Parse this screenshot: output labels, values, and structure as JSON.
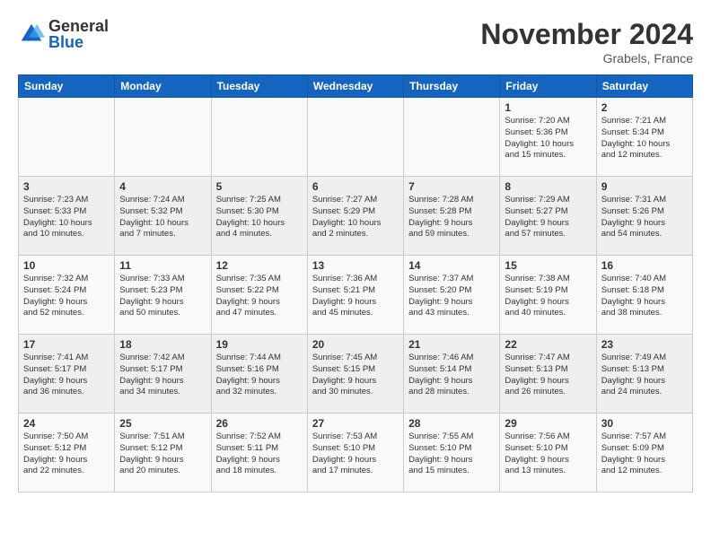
{
  "header": {
    "logo_general": "General",
    "logo_blue": "Blue",
    "month_title": "November 2024",
    "location": "Grabels, France"
  },
  "weekdays": [
    "Sunday",
    "Monday",
    "Tuesday",
    "Wednesday",
    "Thursday",
    "Friday",
    "Saturday"
  ],
  "weeks": [
    [
      {
        "day": "",
        "info": ""
      },
      {
        "day": "",
        "info": ""
      },
      {
        "day": "",
        "info": ""
      },
      {
        "day": "",
        "info": ""
      },
      {
        "day": "",
        "info": ""
      },
      {
        "day": "1",
        "info": "Sunrise: 7:20 AM\nSunset: 5:36 PM\nDaylight: 10 hours\nand 15 minutes."
      },
      {
        "day": "2",
        "info": "Sunrise: 7:21 AM\nSunset: 5:34 PM\nDaylight: 10 hours\nand 12 minutes."
      }
    ],
    [
      {
        "day": "3",
        "info": "Sunrise: 7:23 AM\nSunset: 5:33 PM\nDaylight: 10 hours\nand 10 minutes."
      },
      {
        "day": "4",
        "info": "Sunrise: 7:24 AM\nSunset: 5:32 PM\nDaylight: 10 hours\nand 7 minutes."
      },
      {
        "day": "5",
        "info": "Sunrise: 7:25 AM\nSunset: 5:30 PM\nDaylight: 10 hours\nand 4 minutes."
      },
      {
        "day": "6",
        "info": "Sunrise: 7:27 AM\nSunset: 5:29 PM\nDaylight: 10 hours\nand 2 minutes."
      },
      {
        "day": "7",
        "info": "Sunrise: 7:28 AM\nSunset: 5:28 PM\nDaylight: 9 hours\nand 59 minutes."
      },
      {
        "day": "8",
        "info": "Sunrise: 7:29 AM\nSunset: 5:27 PM\nDaylight: 9 hours\nand 57 minutes."
      },
      {
        "day": "9",
        "info": "Sunrise: 7:31 AM\nSunset: 5:26 PM\nDaylight: 9 hours\nand 54 minutes."
      }
    ],
    [
      {
        "day": "10",
        "info": "Sunrise: 7:32 AM\nSunset: 5:24 PM\nDaylight: 9 hours\nand 52 minutes."
      },
      {
        "day": "11",
        "info": "Sunrise: 7:33 AM\nSunset: 5:23 PM\nDaylight: 9 hours\nand 50 minutes."
      },
      {
        "day": "12",
        "info": "Sunrise: 7:35 AM\nSunset: 5:22 PM\nDaylight: 9 hours\nand 47 minutes."
      },
      {
        "day": "13",
        "info": "Sunrise: 7:36 AM\nSunset: 5:21 PM\nDaylight: 9 hours\nand 45 minutes."
      },
      {
        "day": "14",
        "info": "Sunrise: 7:37 AM\nSunset: 5:20 PM\nDaylight: 9 hours\nand 43 minutes."
      },
      {
        "day": "15",
        "info": "Sunrise: 7:38 AM\nSunset: 5:19 PM\nDaylight: 9 hours\nand 40 minutes."
      },
      {
        "day": "16",
        "info": "Sunrise: 7:40 AM\nSunset: 5:18 PM\nDaylight: 9 hours\nand 38 minutes."
      }
    ],
    [
      {
        "day": "17",
        "info": "Sunrise: 7:41 AM\nSunset: 5:17 PM\nDaylight: 9 hours\nand 36 minutes."
      },
      {
        "day": "18",
        "info": "Sunrise: 7:42 AM\nSunset: 5:17 PM\nDaylight: 9 hours\nand 34 minutes."
      },
      {
        "day": "19",
        "info": "Sunrise: 7:44 AM\nSunset: 5:16 PM\nDaylight: 9 hours\nand 32 minutes."
      },
      {
        "day": "20",
        "info": "Sunrise: 7:45 AM\nSunset: 5:15 PM\nDaylight: 9 hours\nand 30 minutes."
      },
      {
        "day": "21",
        "info": "Sunrise: 7:46 AM\nSunset: 5:14 PM\nDaylight: 9 hours\nand 28 minutes."
      },
      {
        "day": "22",
        "info": "Sunrise: 7:47 AM\nSunset: 5:13 PM\nDaylight: 9 hours\nand 26 minutes."
      },
      {
        "day": "23",
        "info": "Sunrise: 7:49 AM\nSunset: 5:13 PM\nDaylight: 9 hours\nand 24 minutes."
      }
    ],
    [
      {
        "day": "24",
        "info": "Sunrise: 7:50 AM\nSunset: 5:12 PM\nDaylight: 9 hours\nand 22 minutes."
      },
      {
        "day": "25",
        "info": "Sunrise: 7:51 AM\nSunset: 5:12 PM\nDaylight: 9 hours\nand 20 minutes."
      },
      {
        "day": "26",
        "info": "Sunrise: 7:52 AM\nSunset: 5:11 PM\nDaylight: 9 hours\nand 18 minutes."
      },
      {
        "day": "27",
        "info": "Sunrise: 7:53 AM\nSunset: 5:10 PM\nDaylight: 9 hours\nand 17 minutes."
      },
      {
        "day": "28",
        "info": "Sunrise: 7:55 AM\nSunset: 5:10 PM\nDaylight: 9 hours\nand 15 minutes."
      },
      {
        "day": "29",
        "info": "Sunrise: 7:56 AM\nSunset: 5:10 PM\nDaylight: 9 hours\nand 13 minutes."
      },
      {
        "day": "30",
        "info": "Sunrise: 7:57 AM\nSunset: 5:09 PM\nDaylight: 9 hours\nand 12 minutes."
      }
    ]
  ]
}
